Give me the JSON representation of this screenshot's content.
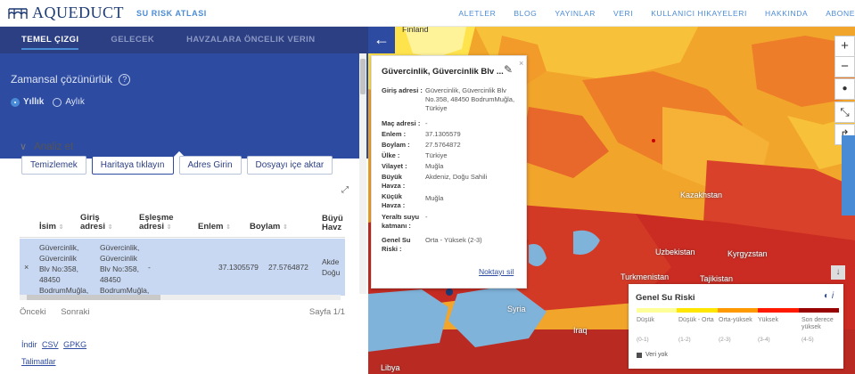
{
  "header": {
    "logo": "AQUEDUCT",
    "atlas": "SU RISK ATLASI",
    "nav": [
      "ALETLER",
      "BLOG",
      "YAYINLAR",
      "VERI",
      "KULLANICI HIKAYELERI",
      "HAKKINDA",
      "ABONE"
    ]
  },
  "tabs": [
    "TEMEL ÇIZGI",
    "GELECEK",
    "HAVZALARA ÖNCELIK VERIN"
  ],
  "resolution": {
    "label": "Zamansal çözünürlük",
    "help": "?",
    "options": [
      "Yıllık",
      "Aylık"
    ],
    "selected": "Yıllık"
  },
  "analyze": {
    "title": "Analiz et",
    "buttons": [
      "Temizlemek",
      "Haritaya tıklayın",
      "Adres Girin",
      "Dosyayı içe aktar"
    ],
    "selected": "Haritaya tıklayın"
  },
  "table": {
    "headers": [
      "İsim",
      "Giriş adresi",
      "Eşleşme adresi",
      "Enlem",
      "Boylam",
      "Büyü Havz"
    ],
    "row": {
      "remove": "×",
      "name": "Güvercinlik, Güvercinlik Blv No:358, 48450 BodrumMuğla,",
      "input": "Güvercinlik, Güvercinlik Blv No:358, 48450 BodrumMuğla,",
      "match": "-",
      "lat": "37.1305579",
      "lon": "27.5764872",
      "basin": "Akde Doğu"
    }
  },
  "pager": {
    "prev": "Önceki",
    "next": "Sonraki",
    "page": "Sayfa 1/1"
  },
  "download": {
    "label": "İndir",
    "csv": "CSV",
    "gpkg": "GPKG"
  },
  "instructions": "Talimatlar",
  "popup": {
    "title": "Güvercinlik, Güvercinlik Blv ...",
    "fields": [
      {
        "label": "Giriş adresi :",
        "value": "Güvercinlik, Güvercinlik Blv No.358, 48450 BodrumMuğla, Türkiye"
      },
      {
        "label": "Maç adresi :",
        "value": "-"
      },
      {
        "label": "Enlem :",
        "value": "37.1305579"
      },
      {
        "label": "Boylam :",
        "value": "27.5764872"
      },
      {
        "label": "Ülke :",
        "value": "Türkiye"
      },
      {
        "label": "Vilayet :",
        "value": "Muğla"
      },
      {
        "label": "Büyük Havza :",
        "value": "Akdeniz, Doğu Sahili"
      },
      {
        "label": "Küçük Havza :",
        "value": "Muğla"
      },
      {
        "label": "Yeraltı suyu katmanı :",
        "value": "-"
      },
      {
        "label": "Genel Su Riski :",
        "value": "Orta - Yüksek (2-3)"
      }
    ],
    "delete": "Noktayı sil"
  },
  "legend": {
    "title": "Genel Su Riski",
    "colors": [
      "#ffff99",
      "#ffe600",
      "#ff9900",
      "#ff1900",
      "#990000"
    ],
    "categories": [
      "Düşük",
      "Düşük - Orta",
      "Orta-yüksek",
      "Yüksek",
      "Son derece yüksek"
    ],
    "ranges": [
      "(0-1)",
      "(1-2)",
      "(2-3)",
      "(3-4)",
      "(4-5)"
    ],
    "nodata": "Veri yok"
  },
  "map_labels": [
    "Finland",
    "Kazakhstan",
    "Uzbekistan",
    "Kyrgyzstan",
    "Turkmenistan",
    "Tajikistan",
    "Iraq",
    "Libya",
    "Syria"
  ]
}
